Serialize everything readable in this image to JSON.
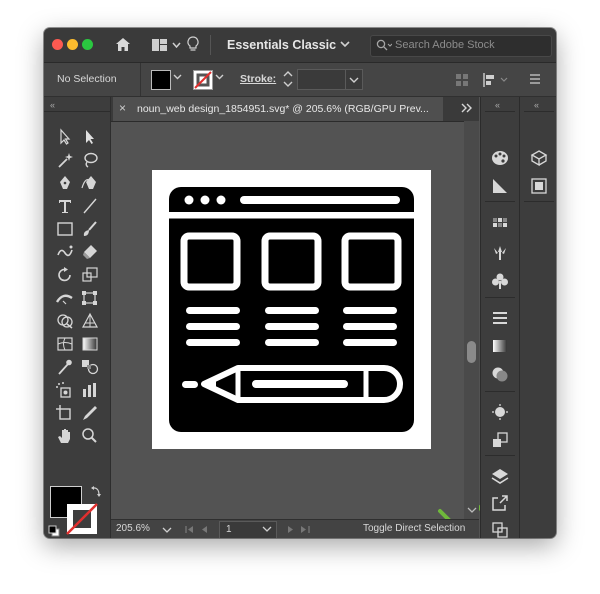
{
  "titlebar": {
    "workspace": "Essentials Classic",
    "search_placeholder": "Search Adobe Stock"
  },
  "control_bar": {
    "selection_label": "No Selection",
    "stroke_label": "Stroke:"
  },
  "document": {
    "tab_title": "noun_web design_1854951.svg* @ 205.6% (RGB/GPU Prev..."
  },
  "status_bar": {
    "zoom": "205.6%",
    "artboard_number": "1",
    "status_text": "Toggle Direct Selection"
  },
  "colors": {
    "fill": "#000000",
    "accent_check": "#6fb83b",
    "window_bg": "#535353",
    "panel_bg": "#3d3d3d"
  },
  "icons": [
    "home-icon",
    "workspace-switcher-icon",
    "lightbulb-icon",
    "search-icon",
    "selection-tool-icon",
    "direct-selection-tool-icon",
    "magic-wand-icon",
    "lasso-icon",
    "pen-icon",
    "curvature-icon",
    "type-icon",
    "line-icon",
    "rectangle-icon",
    "paintbrush-icon",
    "shaper-icon",
    "eraser-icon",
    "rotate-icon",
    "scale-icon",
    "width-icon",
    "free-transform-icon",
    "shape-builder-icon",
    "perspective-icon",
    "mesh-icon",
    "gradient-icon",
    "eyedropper-icon",
    "blend-icon",
    "symbol-sprayer-icon",
    "column-graph-icon",
    "artboard-icon",
    "slice-icon",
    "hand-icon",
    "zoom-icon",
    "checkmark-icon"
  ]
}
